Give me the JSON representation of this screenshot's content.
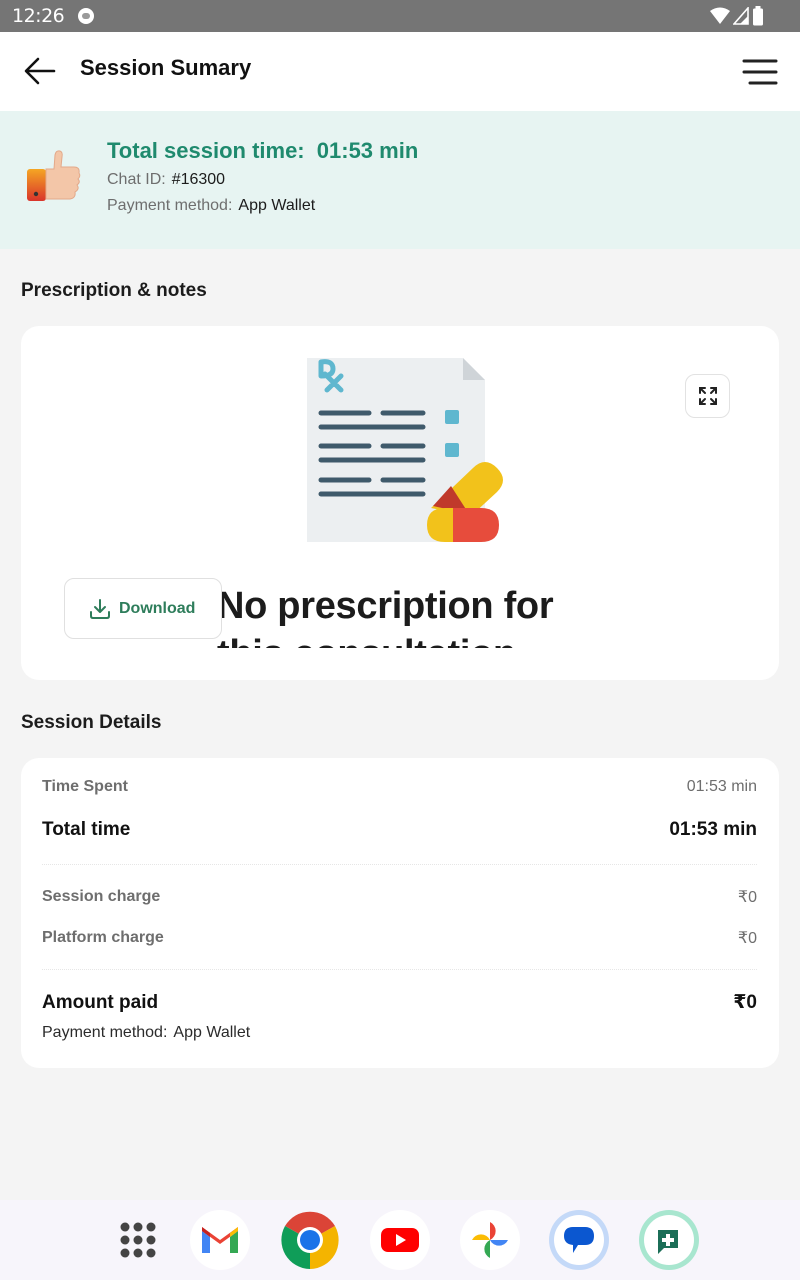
{
  "status_bar": {
    "time": "12:26",
    "icons": [
      "notification-dot-icon",
      "wifi-icon",
      "signal-icon",
      "battery-icon"
    ]
  },
  "app_bar": {
    "title": "Session Sumary",
    "back_icon": "arrow-left-icon",
    "menu_icon": "hamburger-menu-icon"
  },
  "summary": {
    "icon": "thumbs-up-icon",
    "total_label": "Total session time:",
    "total_value": "01:53 min",
    "chat_id_label": "Chat ID:",
    "chat_id_value": "#16300",
    "payment_label": "Payment method:",
    "payment_value": "App Wallet"
  },
  "prescription": {
    "section_title": "Prescription & notes",
    "illustration": "prescription-document-icon",
    "expand_icon": "expand-arrows-icon",
    "empty_message": "No prescription for this consultation",
    "download_label": "Download",
    "download_icon": "download-icon"
  },
  "session_details": {
    "section_title": "Session Details",
    "time_spent_label": "Time Spent",
    "time_spent_value": "01:53 min",
    "total_time_label": "Total time",
    "total_time_value": "01:53 min",
    "session_charge_label": "Session charge",
    "session_charge_value": "₹0",
    "platform_charge_label": "Platform charge",
    "platform_charge_value": "₹0",
    "amount_paid_label": "Amount paid",
    "amount_paid_value": "₹0",
    "payment_label": "Payment method:",
    "payment_value": "App Wallet"
  },
  "dock": {
    "apps": [
      "app-drawer",
      "Gmail",
      "Chrome",
      "YouTube",
      "Photos",
      "Messages",
      "Health app"
    ]
  },
  "colors": {
    "accent_green": "#1f8a6e",
    "banner_bg": "#e7f4f2",
    "download_green": "#2e7d5b"
  }
}
